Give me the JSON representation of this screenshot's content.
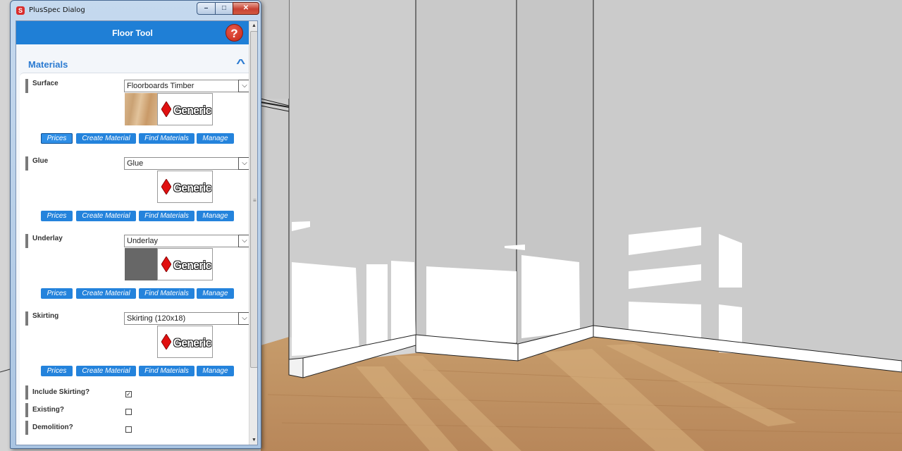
{
  "window": {
    "title": "PlusSpec Dialog",
    "app_icon": "sketchup-icon",
    "controls": {
      "minimize": "–",
      "maximize": "□",
      "close": "✕"
    }
  },
  "dialog": {
    "title": "Floor Tool",
    "help_symbol": "?",
    "section_title": "Materials",
    "collapse_symbol": "^"
  },
  "materials": [
    {
      "label": "Surface",
      "selected": "Floorboards Timber",
      "swatch": "wood",
      "brand": "Generic"
    },
    {
      "label": "Glue",
      "selected": "Glue",
      "swatch": "none",
      "brand": "Generic"
    },
    {
      "label": "Underlay",
      "selected": "Underlay",
      "swatch": "grey",
      "brand": "Generic"
    },
    {
      "label": "Skirting",
      "selected": "Skirting (120x18)",
      "swatch": "none",
      "brand": "Generic"
    }
  ],
  "material_actions": {
    "prices": "Prices",
    "create": "Create Material",
    "find": "Find Materials",
    "manage": "Manage"
  },
  "options": [
    {
      "label": "Include Skirting?",
      "checked": true
    },
    {
      "label": "Existing?",
      "checked": false
    },
    {
      "label": "Demolition?",
      "checked": false
    }
  ],
  "scrollbar": {
    "up": "▲",
    "down": "▼",
    "grip": "≡"
  },
  "colors": {
    "accent": "#1f7fd6",
    "help": "#c32718",
    "brand_diamond": "#e01010"
  }
}
